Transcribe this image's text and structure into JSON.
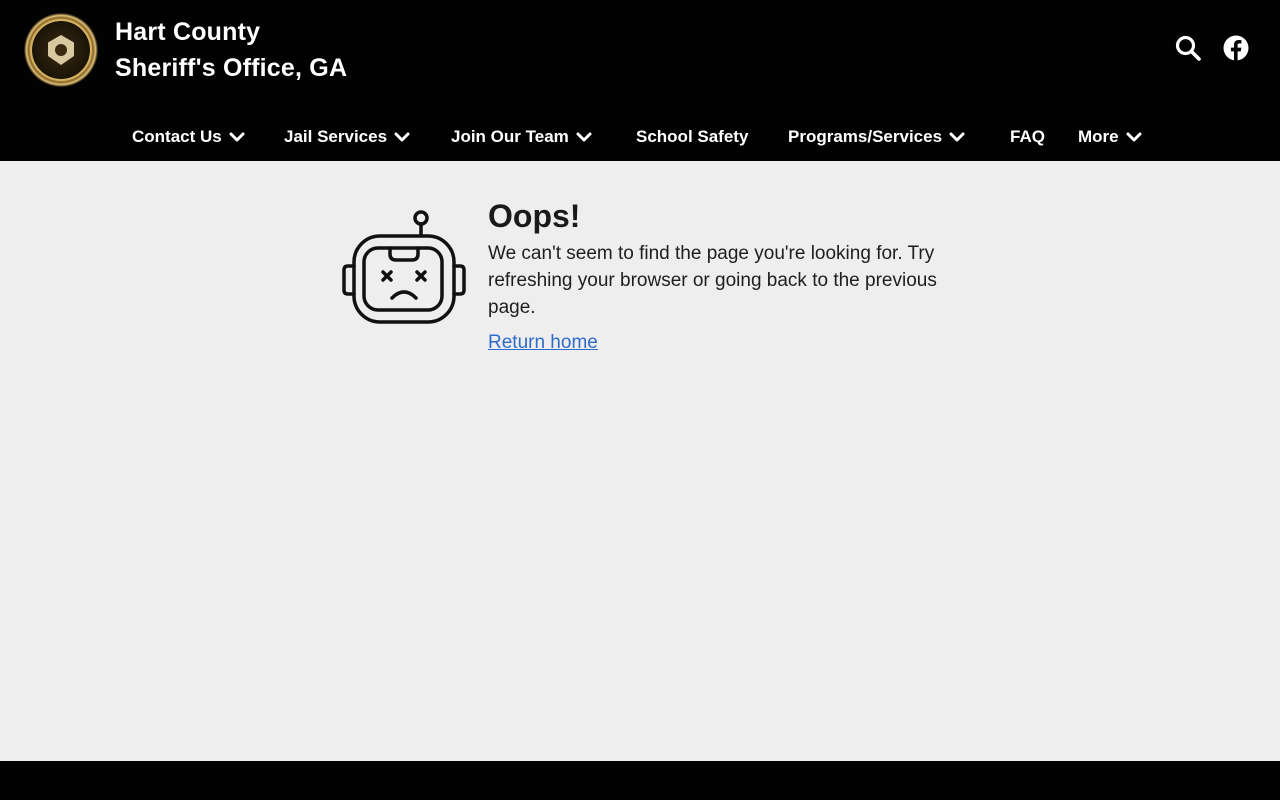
{
  "header": {
    "title_line1": "Hart County",
    "title_line2": "Sheriff's Office, GA",
    "logo_icon": "sheriff-seal-icon",
    "search_icon": "search-icon",
    "facebook_icon": "facebook-icon"
  },
  "nav": {
    "items": [
      {
        "label": "Contact Us",
        "has_dropdown": true
      },
      {
        "label": "Jail Services",
        "has_dropdown": true
      },
      {
        "label": "Join Our Team",
        "has_dropdown": true
      },
      {
        "label": "School Safety",
        "has_dropdown": false
      },
      {
        "label": "Programs/Services",
        "has_dropdown": true
      },
      {
        "label": "FAQ",
        "has_dropdown": false
      },
      {
        "label": "More",
        "has_dropdown": true
      }
    ]
  },
  "error": {
    "icon": "sad-robot-icon",
    "title": "Oops!",
    "message": "We can't seem to find the page you're looking for. Try refreshing your browser or going back to the previous page.",
    "link_label": "Return home"
  },
  "colors": {
    "header_bg": "#020202",
    "page_bg": "#eeeeee",
    "link": "#2f6bc9",
    "nav_text": "#ffffff"
  }
}
